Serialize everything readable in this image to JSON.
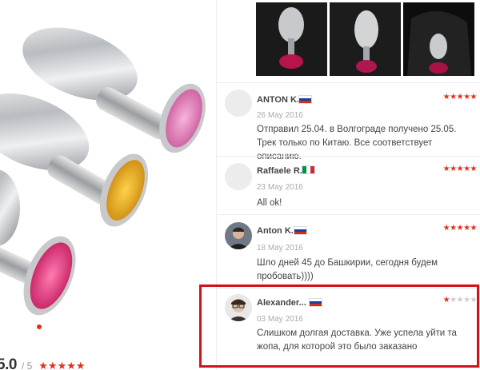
{
  "product": {
    "rating_value": "5.0",
    "rating_outof": "/ 5",
    "rating_stars": "★★★★★"
  },
  "reviews": [
    {
      "name": "ANTON K.",
      "country": "RU",
      "date": "26 May 2016",
      "stars": 5,
      "text": "Отправил 25.04. в Волгограде получено 25.05. Трек только по Китаю. Все соответствует описанию."
    },
    {
      "name": "Raffaele R.",
      "country": "IT",
      "date": "23 May 2016",
      "stars": 5,
      "text": "All ok!"
    },
    {
      "name": "Anton K.",
      "country": "RU",
      "date": "18 May 2016",
      "stars": 5,
      "text": "Шло дней 45 до Башкирии, сегодня будем пробовать))))"
    },
    {
      "name": "Alexander...",
      "country": "RU",
      "date": "03 May 2016",
      "stars": 1,
      "text": "Слишком долгая доставка. Уже успела уйти та жопа, для которой это было заказано"
    }
  ],
  "colors": {
    "accent": "#e0301e",
    "highlight_border": "#d4111a",
    "star_off": "#cccccc"
  },
  "icons": {
    "star": "star-icon",
    "flag_ru": "russia-flag-icon",
    "flag_it": "italy-flag-icon"
  }
}
